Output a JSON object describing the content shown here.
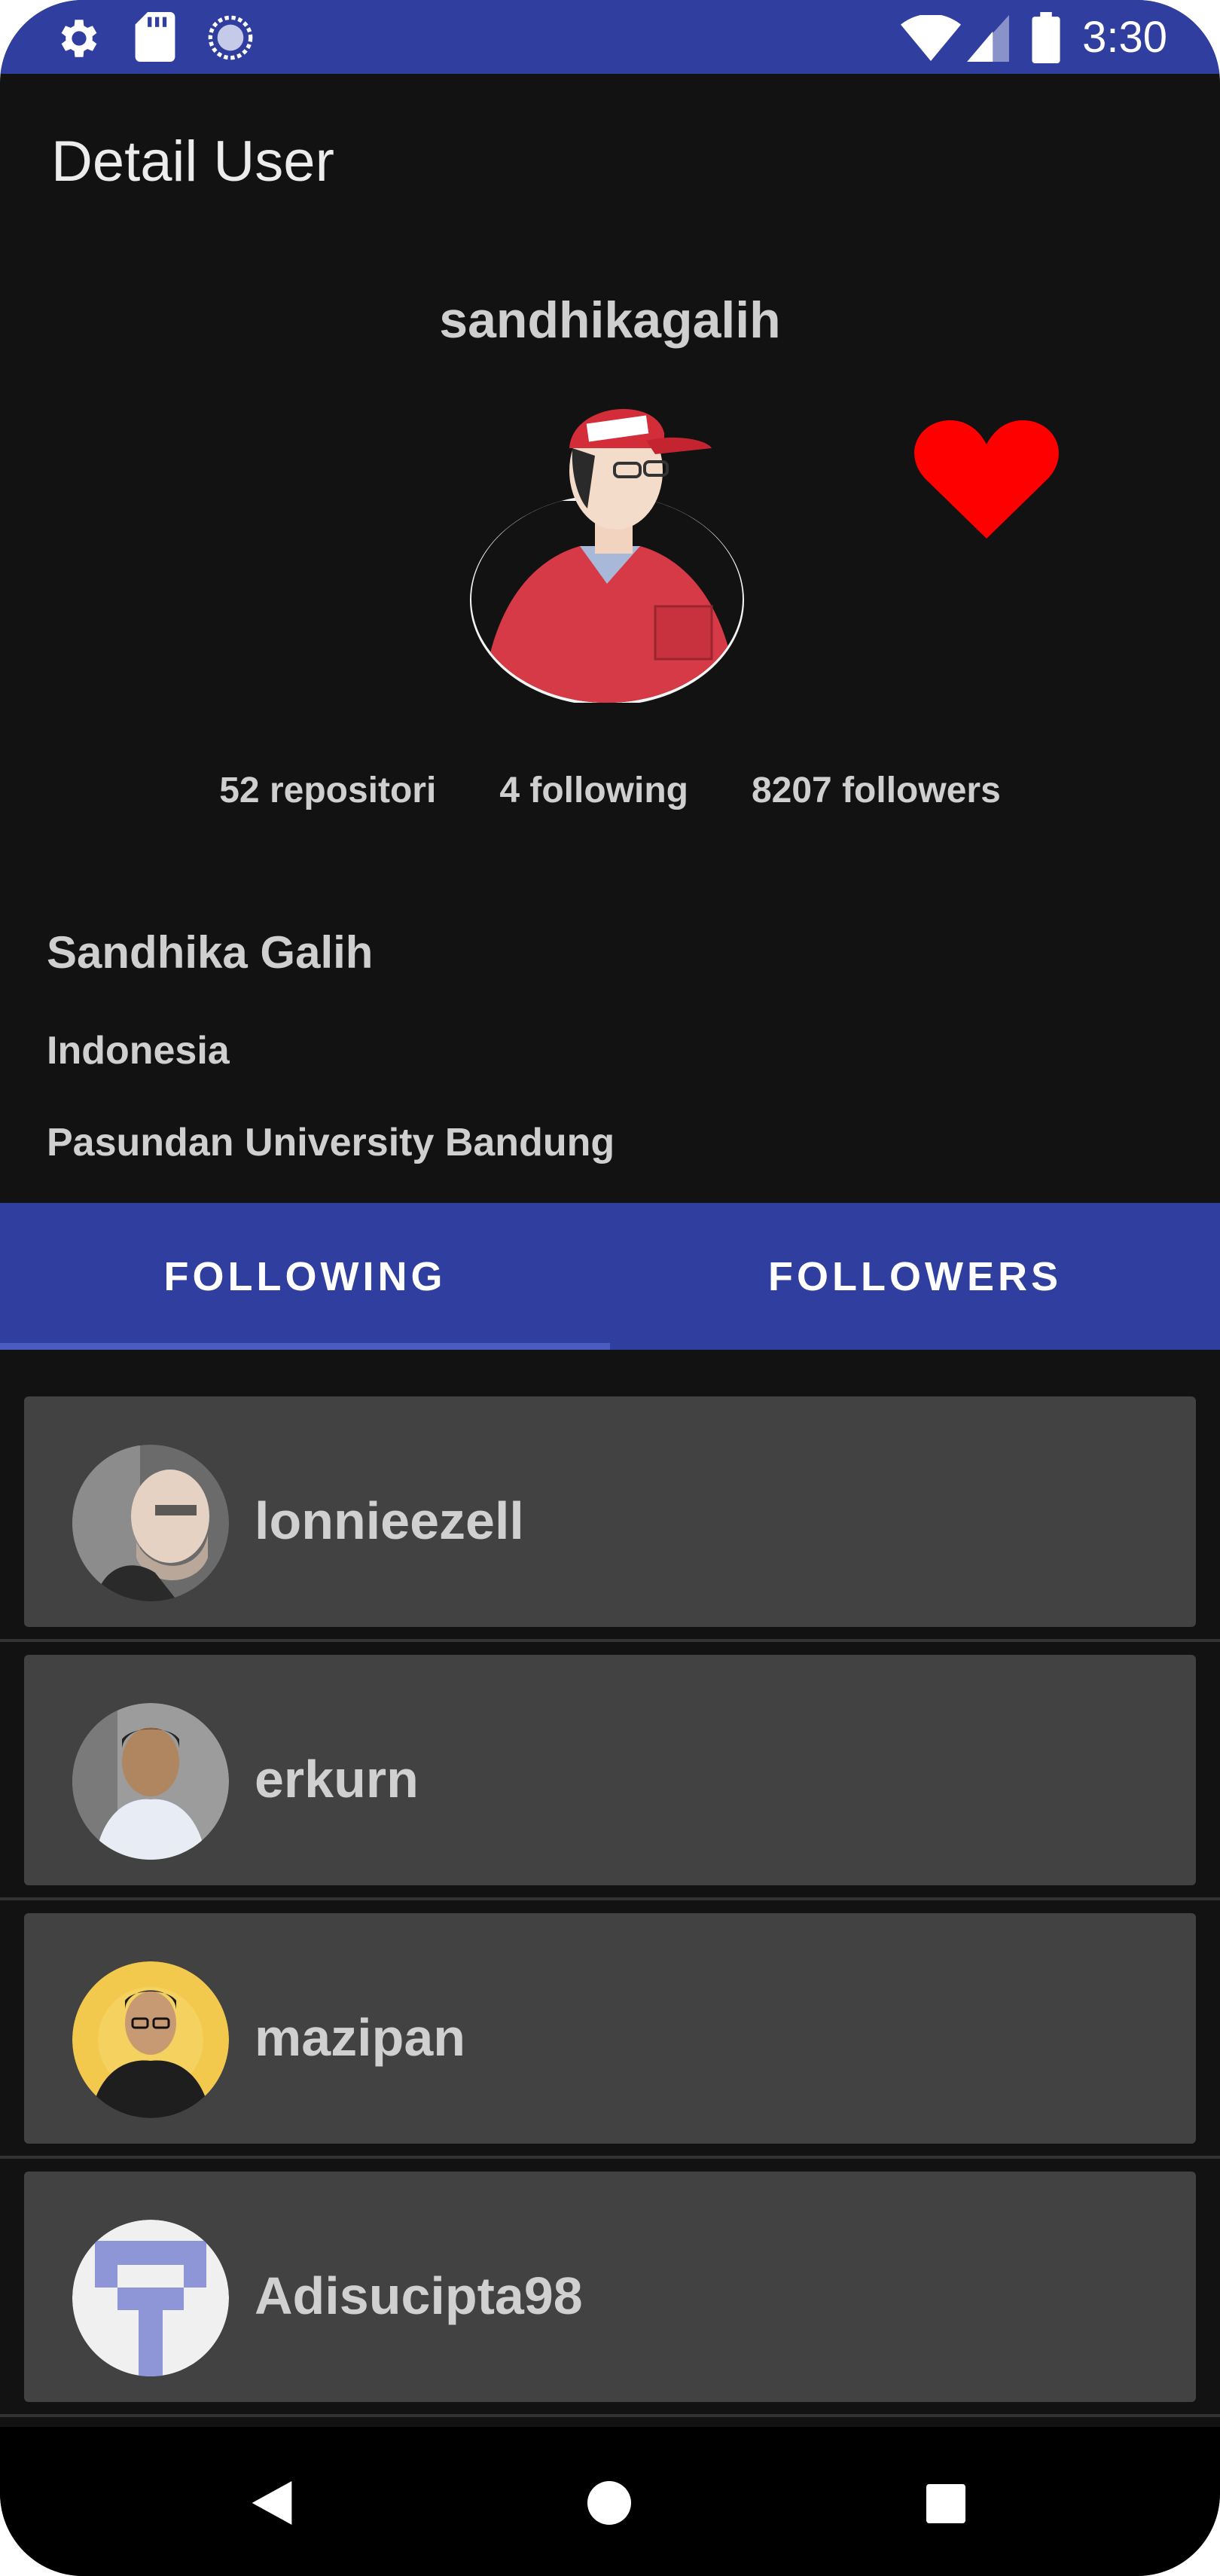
{
  "status_bar": {
    "time": "3:30",
    "icons_left": [
      "gear-icon",
      "sd-card-icon",
      "sync-icon"
    ],
    "icons_right": [
      "wifi-icon",
      "signal-icon",
      "battery-icon"
    ]
  },
  "app_bar": {
    "title": "Detail User"
  },
  "profile": {
    "username": "sandhikagalih",
    "stats": {
      "repositories": "52 repositori",
      "following": "4 following",
      "followers": "8207 followers"
    },
    "name": "Sandhika Galih",
    "location": "Indonesia",
    "company": "Pasundan University Bandung",
    "favorite": true
  },
  "tabs": [
    {
      "label": "FOLLOWING",
      "selected": true
    },
    {
      "label": "FOLLOWERS",
      "selected": false
    }
  ],
  "following_list": [
    {
      "login": "lonnieezell"
    },
    {
      "login": "erkurn"
    },
    {
      "login": "mazipan"
    },
    {
      "login": "Adisucipta98"
    }
  ],
  "colors": {
    "primary": "#303f9f",
    "background": "#121212",
    "card": "#424242",
    "favorite": "#ff0000",
    "text": "#cfcfcf"
  },
  "navigation": [
    "back-icon",
    "home-icon",
    "recents-icon"
  ]
}
